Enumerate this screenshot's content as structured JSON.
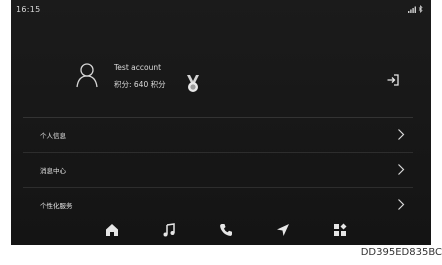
{
  "status_bar": {
    "time": "16:15",
    "signal_icon": "signal-icon",
    "bluetooth_icon": "bluetooth-icon"
  },
  "profile": {
    "account_name": "Test account",
    "points_text": "积分: 640 积分",
    "avatar_icon": "person-outline-icon",
    "medal_icon": "medal-icon",
    "logout_icon": "logout-icon"
  },
  "menu": {
    "items": [
      {
        "label": "个人信息"
      },
      {
        "label": "消息中心"
      },
      {
        "label": "个性化服务"
      }
    ]
  },
  "dock": {
    "items": [
      "home-icon",
      "music-icon",
      "phone-icon",
      "navigation-icon",
      "apps-icon"
    ]
  },
  "watermark": "DD395ED835BC",
  "colors": {
    "background": "#181818",
    "text": "#e9e9e9",
    "divider": "#2d2d2d"
  }
}
